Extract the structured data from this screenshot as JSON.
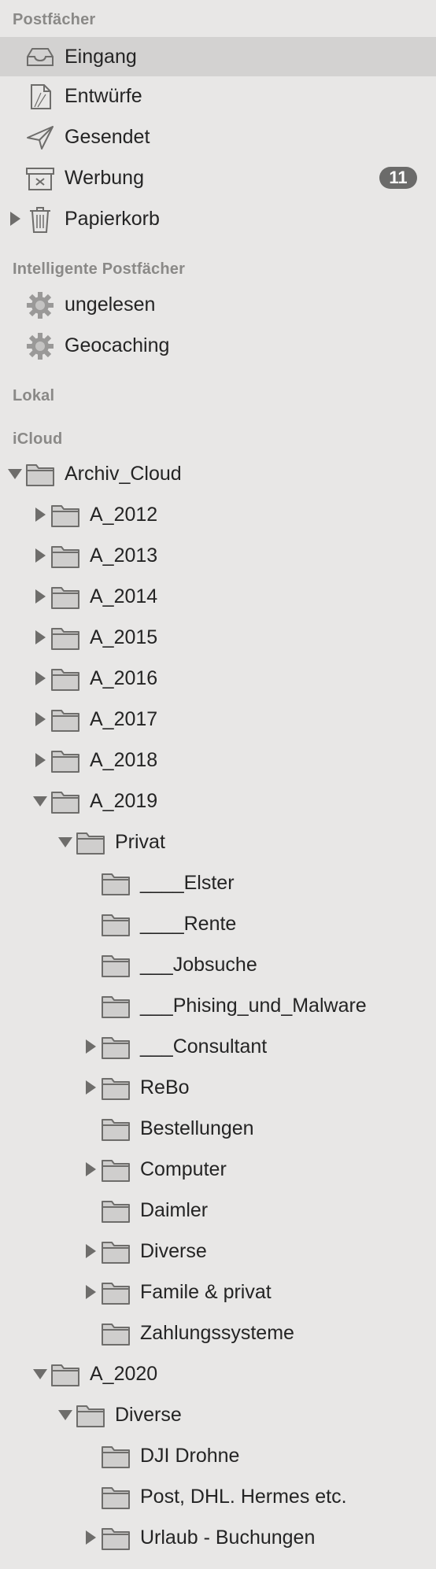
{
  "sections": {
    "postfaecher": "Postfächer",
    "intelligent": "Intelligente Postfächer",
    "lokal": "Lokal",
    "icloud": "iCloud"
  },
  "mailboxes": [
    {
      "label": "Eingang",
      "icon": "inbox-icon"
    },
    {
      "label": "Entwürfe",
      "icon": "drafts-icon"
    },
    {
      "label": "Gesendet",
      "icon": "sent-icon"
    },
    {
      "label": "Werbung",
      "icon": "junk-icon",
      "badge": "11"
    },
    {
      "label": "Papierkorb",
      "icon": "trash-icon"
    }
  ],
  "smart_mailboxes": [
    {
      "label": "ungelesen",
      "icon": "gear-icon"
    },
    {
      "label": "Geocaching",
      "icon": "gear-icon"
    }
  ],
  "icloud_folders": [
    {
      "label": "Archiv_Cloud",
      "depth": 0,
      "disclosure": "expanded"
    },
    {
      "label": "A_2012",
      "depth": 1,
      "disclosure": "collapsed"
    },
    {
      "label": "A_2013",
      "depth": 1,
      "disclosure": "collapsed"
    },
    {
      "label": "A_2014",
      "depth": 1,
      "disclosure": "collapsed"
    },
    {
      "label": "A_2015",
      "depth": 1,
      "disclosure": "collapsed"
    },
    {
      "label": "A_2016",
      "depth": 1,
      "disclosure": "collapsed"
    },
    {
      "label": "A_2017",
      "depth": 1,
      "disclosure": "collapsed"
    },
    {
      "label": "A_2018",
      "depth": 1,
      "disclosure": "collapsed"
    },
    {
      "label": "A_2019",
      "depth": 1,
      "disclosure": "expanded"
    },
    {
      "label": "Privat",
      "depth": 2,
      "disclosure": "expanded"
    },
    {
      "label": "____Elster",
      "depth": 3,
      "disclosure": "none"
    },
    {
      "label": "____Rente",
      "depth": 3,
      "disclosure": "none"
    },
    {
      "label": "___Jobsuche",
      "depth": 3,
      "disclosure": "none"
    },
    {
      "label": "___Phising_und_Malware",
      "depth": 3,
      "disclosure": "none"
    },
    {
      "label": "___Consultant",
      "depth": 3,
      "disclosure": "collapsed"
    },
    {
      "label": "ReBo",
      "depth": 3,
      "disclosure": "collapsed"
    },
    {
      "label": "Bestellungen",
      "depth": 3,
      "disclosure": "none"
    },
    {
      "label": "Computer",
      "depth": 3,
      "disclosure": "collapsed"
    },
    {
      "label": "Daimler",
      "depth": 3,
      "disclosure": "none"
    },
    {
      "label": "Diverse",
      "depth": 3,
      "disclosure": "collapsed"
    },
    {
      "label": "Famile & privat",
      "depth": 3,
      "disclosure": "collapsed"
    },
    {
      "label": "Zahlungssysteme",
      "depth": 3,
      "disclosure": "none"
    },
    {
      "label": "A_2020",
      "depth": 1,
      "disclosure": "expanded"
    },
    {
      "label": "Diverse",
      "depth": 2,
      "disclosure": "expanded"
    },
    {
      "label": "DJI Drohne",
      "depth": 3,
      "disclosure": "none"
    },
    {
      "label": "Post, DHL. Hermes etc.",
      "depth": 3,
      "disclosure": "none"
    },
    {
      "label": "Urlaub - Buchungen",
      "depth": 3,
      "disclosure": "collapsed"
    }
  ],
  "colors": {
    "background": "#e8e7e6",
    "selected_row": "#d3d2d1",
    "section_header": "#8a8987",
    "badge": "#6b6b6a"
  }
}
